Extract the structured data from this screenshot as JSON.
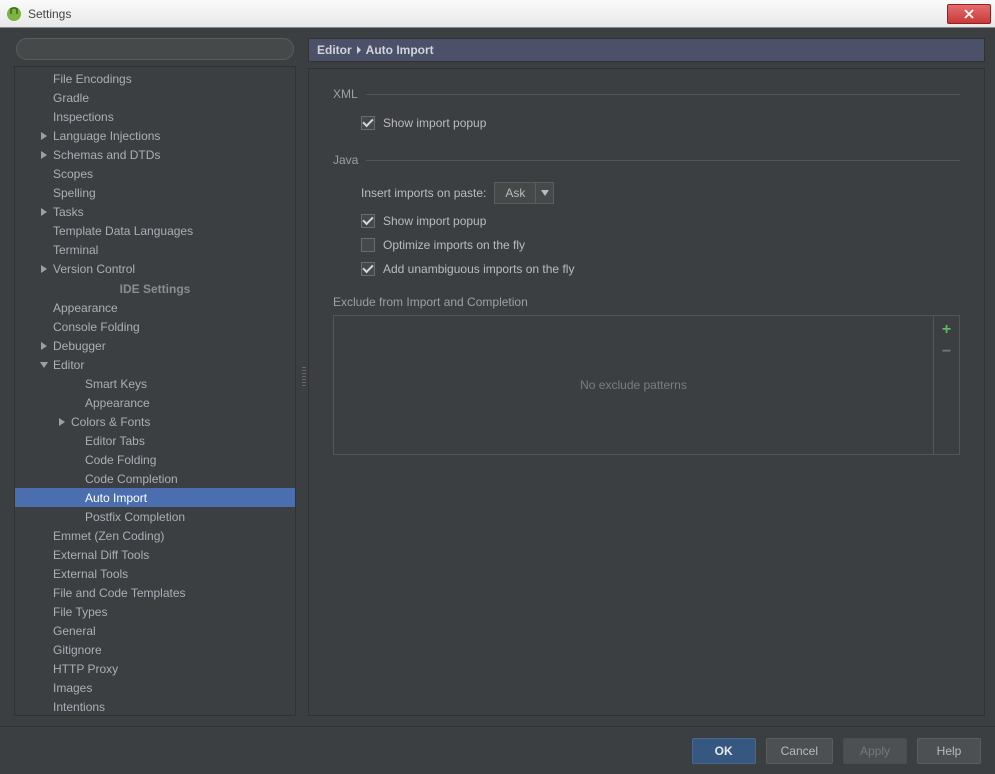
{
  "window": {
    "title": "Settings"
  },
  "breadcrumb": {
    "root": "Editor",
    "leaf": "Auto Import"
  },
  "sidebar": {
    "ide_section": "IDE Settings",
    "items_top": [
      {
        "label": "File Encodings",
        "indent": 1,
        "arrow": ""
      },
      {
        "label": "Gradle",
        "indent": 1,
        "arrow": ""
      },
      {
        "label": "Inspections",
        "indent": 1,
        "arrow": ""
      },
      {
        "label": "Language Injections",
        "indent": 1,
        "arrow": "right"
      },
      {
        "label": "Schemas and DTDs",
        "indent": 1,
        "arrow": "right"
      },
      {
        "label": "Scopes",
        "indent": 1,
        "arrow": ""
      },
      {
        "label": "Spelling",
        "indent": 1,
        "arrow": ""
      },
      {
        "label": "Tasks",
        "indent": 1,
        "arrow": "right"
      },
      {
        "label": "Template Data Languages",
        "indent": 1,
        "arrow": ""
      },
      {
        "label": "Terminal",
        "indent": 1,
        "arrow": ""
      },
      {
        "label": "Version Control",
        "indent": 1,
        "arrow": "right"
      }
    ],
    "items_ide": [
      {
        "label": "Appearance",
        "indent": 1,
        "arrow": ""
      },
      {
        "label": "Console Folding",
        "indent": 1,
        "arrow": ""
      },
      {
        "label": "Debugger",
        "indent": 1,
        "arrow": "right"
      },
      {
        "label": "Editor",
        "indent": 1,
        "arrow": "down"
      },
      {
        "label": "Smart Keys",
        "indent": 3,
        "arrow": ""
      },
      {
        "label": "Appearance",
        "indent": 3,
        "arrow": ""
      },
      {
        "label": "Colors & Fonts",
        "indent": 3,
        "arrow": "right",
        "arrowIndent": true
      },
      {
        "label": "Editor Tabs",
        "indent": 3,
        "arrow": ""
      },
      {
        "label": "Code Folding",
        "indent": 3,
        "arrow": ""
      },
      {
        "label": "Code Completion",
        "indent": 3,
        "arrow": ""
      },
      {
        "label": "Auto Import",
        "indent": 3,
        "arrow": "",
        "selected": true
      },
      {
        "label": "Postfix Completion",
        "indent": 3,
        "arrow": ""
      },
      {
        "label": "Emmet (Zen Coding)",
        "indent": 1,
        "arrow": ""
      },
      {
        "label": "External Diff Tools",
        "indent": 1,
        "arrow": ""
      },
      {
        "label": "External Tools",
        "indent": 1,
        "arrow": ""
      },
      {
        "label": "File and Code Templates",
        "indent": 1,
        "arrow": ""
      },
      {
        "label": "File Types",
        "indent": 1,
        "arrow": ""
      },
      {
        "label": "General",
        "indent": 1,
        "arrow": ""
      },
      {
        "label": "Gitignore",
        "indent": 1,
        "arrow": ""
      },
      {
        "label": "HTTP Proxy",
        "indent": 1,
        "arrow": ""
      },
      {
        "label": "Images",
        "indent": 1,
        "arrow": ""
      },
      {
        "label": "Intentions",
        "indent": 1,
        "arrow": ""
      }
    ]
  },
  "content": {
    "xml": {
      "title": "XML",
      "show_import_popup": "Show import popup"
    },
    "java": {
      "title": "Java",
      "insert_label": "Insert imports on paste:",
      "insert_value": "Ask",
      "show_import_popup": "Show import popup",
      "optimize": "Optimize imports on the fly",
      "add_unambiguous": "Add unambiguous imports on the fly"
    },
    "exclude": {
      "title": "Exclude from Import and Completion",
      "empty": "No exclude patterns"
    }
  },
  "footer": {
    "ok": "OK",
    "cancel": "Cancel",
    "apply": "Apply",
    "help": "Help"
  }
}
